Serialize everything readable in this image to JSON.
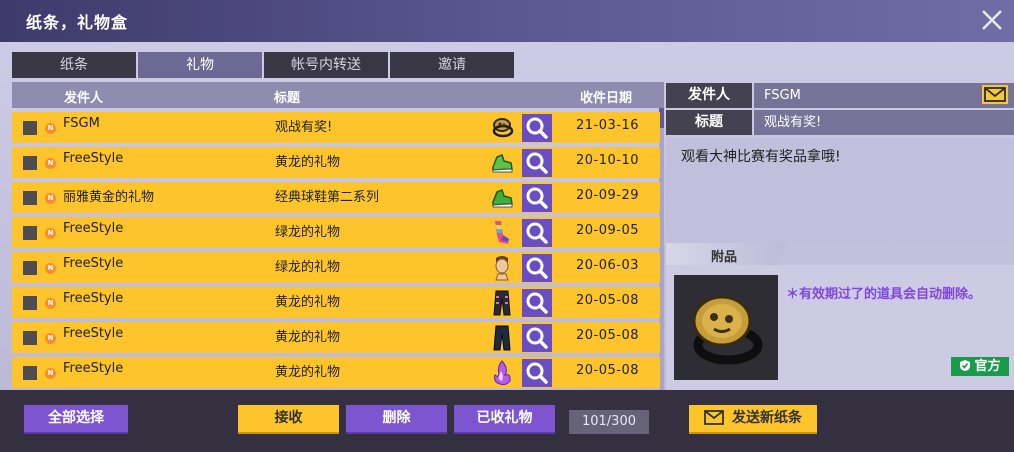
{
  "window": {
    "title": "纸条，礼物盒"
  },
  "tabs": [
    {
      "label": "纸条",
      "active": false
    },
    {
      "label": "礼物",
      "active": true
    },
    {
      "label": "帐号内转送",
      "active": false
    },
    {
      "label": "邀请",
      "active": false
    }
  ],
  "list": {
    "columns": {
      "sender": "发件人",
      "subject": "标题",
      "date": "收件日期"
    },
    "rows": [
      {
        "sender": "FSGM",
        "subject": "观战有奖!",
        "date": "21-03-16",
        "item_icon": "gold-ring-icon"
      },
      {
        "sender": "FreeStyle",
        "subject": "黄龙的礼物",
        "date": "20-10-10",
        "item_icon": "green-sneaker-icon"
      },
      {
        "sender": "丽雅黄金的礼物",
        "subject": "经典球鞋第二系列",
        "date": "20-09-29",
        "item_icon": "green-sneaker-icon"
      },
      {
        "sender": "FreeStyle",
        "subject": "绿龙的礼物",
        "date": "20-09-05",
        "item_icon": "rainbow-sock-icon"
      },
      {
        "sender": "FreeStyle",
        "subject": "绿龙的礼物",
        "date": "20-06-03",
        "item_icon": "face-icon"
      },
      {
        "sender": "FreeStyle",
        "subject": "黄龙的礼物",
        "date": "20-05-08",
        "item_icon": "pants-icon"
      },
      {
        "sender": "FreeStyle",
        "subject": "黄龙的礼物",
        "date": "20-05-08",
        "item_icon": "pants-icon"
      },
      {
        "sender": "FreeStyle",
        "subject": "黄龙的礼物",
        "date": "20-05-08",
        "item_icon": "flame-hand-icon"
      }
    ]
  },
  "detail": {
    "sender_label": "发件人",
    "sender": "FSGM",
    "subject_label": "标题",
    "subject": "观战有奖!",
    "message": "观看大神比赛有奖品拿哦!",
    "attachment_label": "附品",
    "attachment_icon": "gold-ring-icon",
    "notice": "＊有效期过了的道具会自动删除。",
    "official_badge": "官方"
  },
  "footer": {
    "select_all": "全部选择",
    "receive": "接收",
    "delete": "删除",
    "received_gifts": "已收礼物",
    "count": "101/300",
    "send_new": "发送新纸条"
  }
}
